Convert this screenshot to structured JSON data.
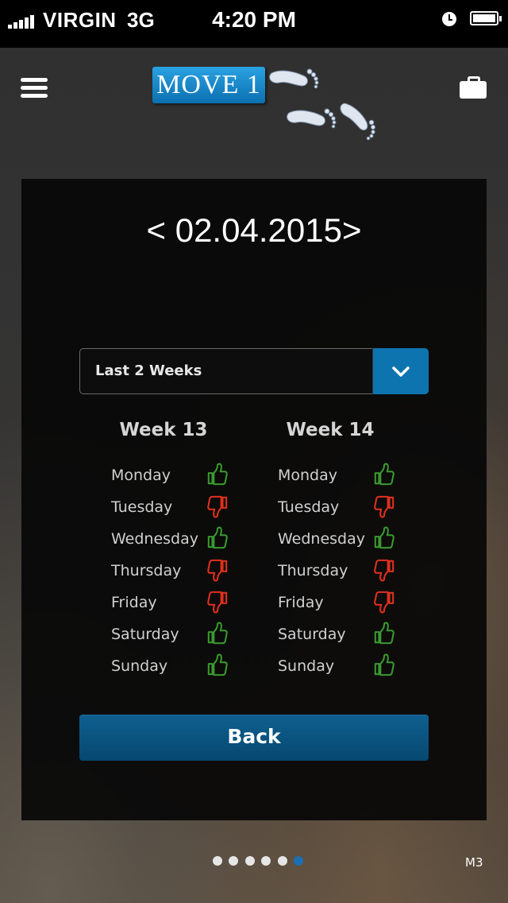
{
  "status_bar": {
    "carrier": "VIRGIN",
    "network": "3G",
    "time": "4:20 PM"
  },
  "header": {
    "logo_text": "MOVE 1",
    "menu_icon": "hamburger-menu-icon",
    "briefcase_icon": "briefcase-icon"
  },
  "date_nav": {
    "prev": "<",
    "date": "02.04.2015",
    "next": ">"
  },
  "period_select": {
    "value": "Last 2 Weeks",
    "toggle_icon": "chevron-down-icon"
  },
  "weeks": [
    {
      "title": "Week 13",
      "days": [
        {
          "name": "Monday",
          "rating": "up"
        },
        {
          "name": "Tuesday",
          "rating": "down"
        },
        {
          "name": "Wednesday",
          "rating": "up"
        },
        {
          "name": "Thursday",
          "rating": "down"
        },
        {
          "name": "Friday",
          "rating": "down"
        },
        {
          "name": "Saturday",
          "rating": "up"
        },
        {
          "name": "Sunday",
          "rating": "up"
        }
      ]
    },
    {
      "title": "Week 14",
      "days": [
        {
          "name": "Monday",
          "rating": "up"
        },
        {
          "name": "Tuesday",
          "rating": "down"
        },
        {
          "name": "Wednesday",
          "rating": "up"
        },
        {
          "name": "Thursday",
          "rating": "down"
        },
        {
          "name": "Friday",
          "rating": "down"
        },
        {
          "name": "Saturday",
          "rating": "up"
        },
        {
          "name": "Sunday",
          "rating": "up"
        }
      ]
    }
  ],
  "back_label": "Back",
  "pager": {
    "count": 6,
    "active": 6
  },
  "page_code": "M3",
  "colors": {
    "thumb_up": "#3a9a2e",
    "thumb_down": "#e0301e",
    "accent": "#0d74b0",
    "pager_active": "#1d6fb4"
  }
}
